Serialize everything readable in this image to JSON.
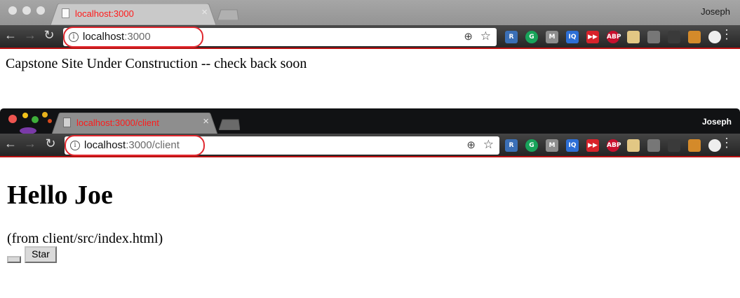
{
  "window1": {
    "tab_title": "localhost:3000",
    "username": "Joseph",
    "address": {
      "host": "localhost",
      "rest": ":3000"
    },
    "page_text": "Capstone Site Under Construction -- check back soon"
  },
  "window2": {
    "tab_title": "localhost:3000/client",
    "username": "Joseph",
    "address": {
      "host": "localhost",
      "rest": ":3000/client"
    },
    "heading": "Hello Joe",
    "subtext": "(from client/src/index.html)",
    "star_button": "Star",
    "empty_button": ""
  },
  "icons": {
    "close": "×",
    "back": "←",
    "forward": "→",
    "reload": "↻",
    "info": "i",
    "zoom": "⊕",
    "star": "☆",
    "menu": "⋮"
  },
  "extensions": [
    {
      "name": "r-extension-icon",
      "label": "R",
      "color": "#3b6fb6"
    },
    {
      "name": "grammarly-icon",
      "label": "G",
      "color": "#18a35a"
    },
    {
      "name": "m-extension-icon",
      "label": "M",
      "color": "#8d8d8d"
    },
    {
      "name": "iq-extension-icon",
      "label": "IQ",
      "color": "#2d6fd6"
    },
    {
      "name": "fastforward-extension-icon",
      "label": "▶▶",
      "color": "#d8222a"
    },
    {
      "name": "adblock-plus-icon",
      "label": "ABP",
      "color": "#c8102e"
    },
    {
      "name": "notes-extension-icon",
      "label": "",
      "color": "#e2c784"
    },
    {
      "name": "bulb-extension-icon",
      "label": "",
      "color": "#777777"
    },
    {
      "name": "dark-extension-icon",
      "label": "",
      "color": "#3a3a3a"
    },
    {
      "name": "flag-extension-icon",
      "label": "",
      "color": "#d48a2a"
    },
    {
      "name": "circle-extension-icon",
      "label": "",
      "color": "#eeeeee"
    }
  ],
  "colors": {
    "tab_title": "#ff1a1a",
    "highlight_ring": "#e0282f",
    "toolbar_bottom": "#bb1111"
  }
}
